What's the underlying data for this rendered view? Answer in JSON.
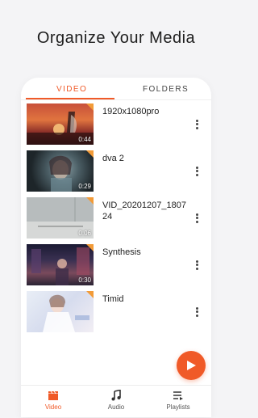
{
  "headline": "Organize Your Media",
  "tabs": {
    "video": "VIDEO",
    "folders": "FOLDERS"
  },
  "videos": [
    {
      "title": "1920x1080pro",
      "duration": "0:44"
    },
    {
      "title": "dva 2",
      "duration": "0:29"
    },
    {
      "title": "VID_20201207_180724",
      "duration": "0:06"
    },
    {
      "title": "Synthesis",
      "duration": "0:30"
    },
    {
      "title": "Timid",
      "duration": ""
    }
  ],
  "bottom_nav": {
    "video": "Video",
    "audio": "Audio",
    "playlists": "Playlists"
  },
  "colors": {
    "accent": "#f05a28",
    "new_badge": "#f29b38"
  }
}
